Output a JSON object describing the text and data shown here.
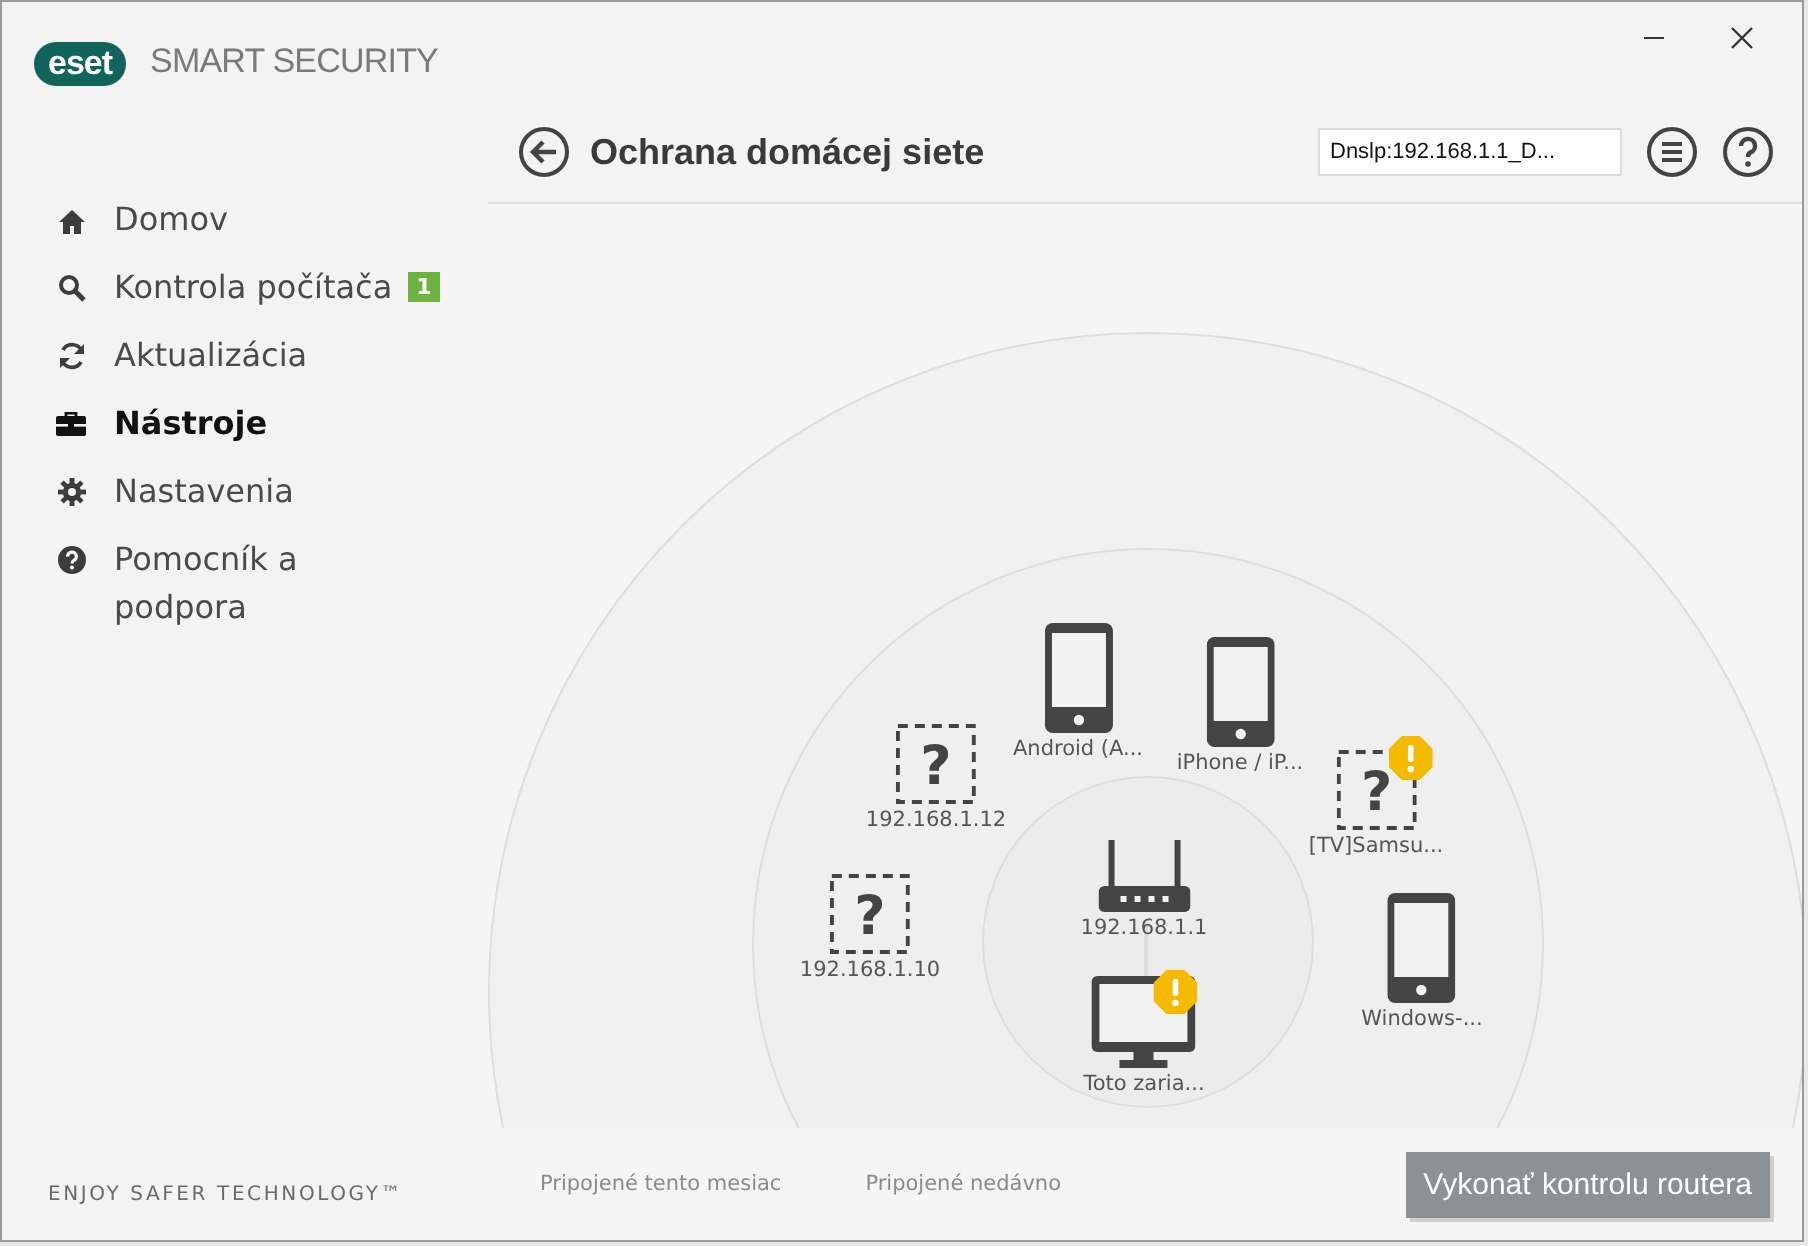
{
  "window": {
    "logo": "eset",
    "title": "SMART SECURITY",
    "controls": [
      {
        "kind": "minimize"
      },
      {
        "kind": "close"
      }
    ]
  },
  "sidebar": {
    "items": [
      {
        "label": "Domov",
        "selected": false
      },
      {
        "label": "Kontrola počítača",
        "badge": "1",
        "selected": false
      },
      {
        "label": "Aktualizácia",
        "selected": false
      },
      {
        "label": "Nástroje",
        "selected": true
      },
      {
        "label": "Nastavenia",
        "selected": false
      },
      {
        "label": "Pomocník a podpora",
        "selected": false
      }
    ],
    "footer": "ENJOY SAFER TECHNOLOGY™"
  },
  "page": {
    "title": "Ochrana domácej siete",
    "network_field": "Dnslp:192.168.1.1_D..."
  },
  "network_map": {
    "devices": [
      {
        "kind": "phone",
        "label": "Android (A...",
        "warning": false
      },
      {
        "kind": "phone",
        "label": "iPhone / iP...",
        "warning": false
      },
      {
        "kind": "unknown",
        "glyph": "?",
        "label": "192.168.1.12",
        "warning": false
      },
      {
        "kind": "unknown",
        "glyph": "?",
        "label": "[TV]Samsu...",
        "warning": true
      },
      {
        "kind": "router",
        "label": "192.168.1.1",
        "warning": false
      },
      {
        "kind": "unknown",
        "glyph": "?",
        "label": "192.168.1.10",
        "warning": false
      },
      {
        "kind": "phone",
        "label": "Windows-...",
        "warning": false
      },
      {
        "kind": "monitor",
        "label": "Toto zaria...",
        "warning": true
      }
    ]
  },
  "bottom_bar": {
    "legend": [
      "Pripojené tento mesiac",
      "Pripojené nedávno"
    ],
    "button": "Vykonať kontrolu routera"
  }
}
